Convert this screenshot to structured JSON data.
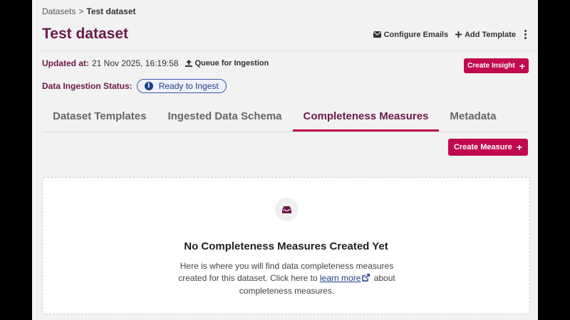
{
  "breadcrumb": {
    "root": "Datasets",
    "separator": ">",
    "current": "Test dataset"
  },
  "page_title": "Test dataset",
  "header_actions": {
    "configure_emails": "Configure Emails",
    "add_template": "Add Template"
  },
  "updated": {
    "label": "Updated at:",
    "value": "21 Nov 2025, 16:19:58",
    "queue_label": "Queue for Ingestion"
  },
  "create_insight_label": "Create Insight",
  "status": {
    "label": "Data Ingestion Status:",
    "value": "Ready to Ingest"
  },
  "tabs": [
    {
      "label": "Dataset Templates",
      "active": false
    },
    {
      "label": "Ingested Data Schema",
      "active": false
    },
    {
      "label": "Completeness Measures",
      "active": true
    },
    {
      "label": "Metadata",
      "active": false
    }
  ],
  "create_measure_label": "Create Measure",
  "empty_state": {
    "title": "No Completeness Measures Created Yet",
    "body_before": "Here is where you will find data completeness measures created for this dataset. Click here to ",
    "link": "learn more",
    "body_after": " about completeness measures."
  },
  "colors": {
    "brand": "#6b1a4d",
    "accent": "#c1094f",
    "info": "#1f3f8a"
  },
  "icons": [
    "envelope-icon",
    "plus-icon",
    "kebab-icon",
    "upload-icon",
    "info-icon",
    "inbox-icon",
    "external-link-icon"
  ]
}
